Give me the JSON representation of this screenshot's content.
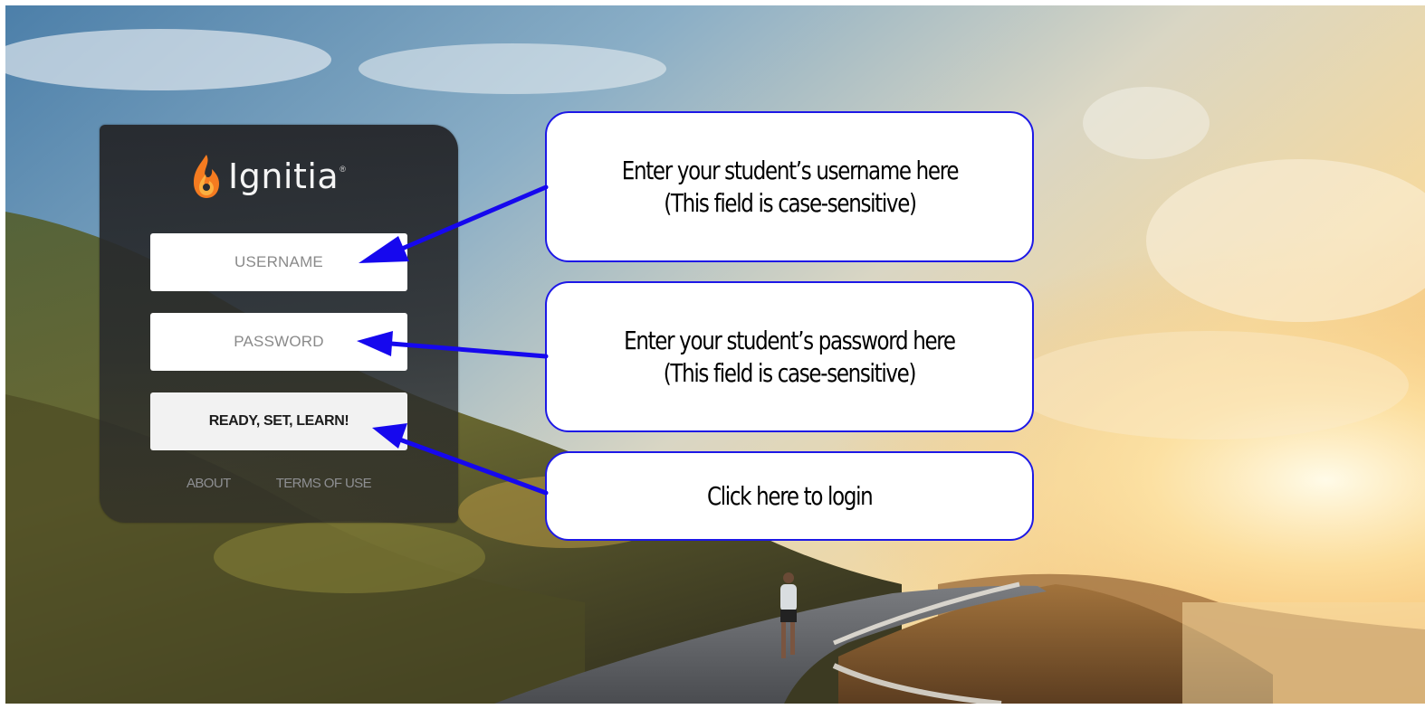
{
  "brand": {
    "name": "Ignitia",
    "registered_mark": "®"
  },
  "login": {
    "username_placeholder": "USERNAME",
    "password_placeholder": "PASSWORD",
    "submit_label": "READY, SET, LEARN!",
    "about_link": "ABOUT",
    "terms_link": "TERMS OF USE"
  },
  "callouts": [
    {
      "line1": "Enter your student’s username here",
      "line2": "(This field is case-sensitive)"
    },
    {
      "line1": "Enter your student’s password here",
      "line2": "(This field is case-sensitive)"
    },
    {
      "line1": "Click here to login"
    }
  ],
  "colors": {
    "callout_border": "#1d18e6",
    "arrow": "#1608ee",
    "flame_orange": "#f47b20",
    "panel": "#2a2c30"
  }
}
